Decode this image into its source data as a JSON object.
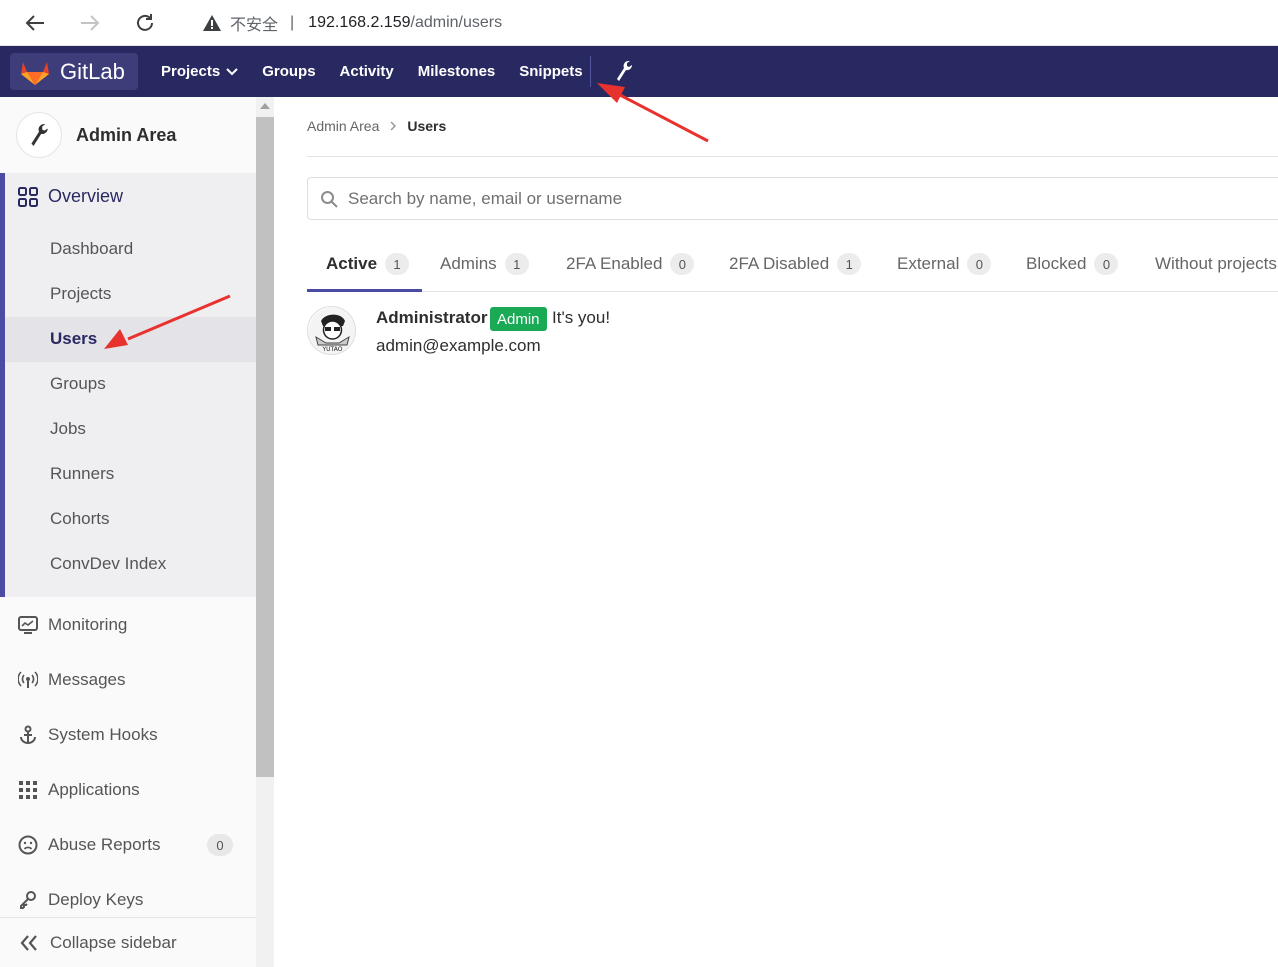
{
  "browser": {
    "warning_label": "不安全",
    "url_host": "192.168.2.159",
    "url_path": "/admin/users"
  },
  "header": {
    "logo_text": "GitLab",
    "nav": [
      {
        "label": "Projects"
      },
      {
        "label": "Groups"
      },
      {
        "label": "Activity"
      },
      {
        "label": "Milestones"
      },
      {
        "label": "Snippets"
      }
    ],
    "colors": {
      "bg": "#292961",
      "accent": "#fc6d26"
    }
  },
  "sidebar": {
    "title": "Admin Area",
    "overview": {
      "label": "Overview",
      "items": [
        {
          "label": "Dashboard"
        },
        {
          "label": "Projects"
        },
        {
          "label": "Users"
        },
        {
          "label": "Groups"
        },
        {
          "label": "Jobs"
        },
        {
          "label": "Runners"
        },
        {
          "label": "Cohorts"
        },
        {
          "label": "ConvDev Index"
        }
      ],
      "active_item": "Users"
    },
    "items": [
      {
        "label": "Monitoring",
        "icon": "monitor-icon"
      },
      {
        "label": "Messages",
        "icon": "broadcast-icon"
      },
      {
        "label": "System Hooks",
        "icon": "anchor-icon"
      },
      {
        "label": "Applications",
        "icon": "apps-grid-icon"
      },
      {
        "label": "Abuse Reports",
        "icon": "frown-face-icon",
        "count": "0"
      },
      {
        "label": "Deploy Keys",
        "icon": "key-icon"
      }
    ],
    "collapse_label": "Collapse sidebar"
  },
  "breadcrumb": {
    "parent": "Admin Area",
    "current": "Users"
  },
  "search": {
    "placeholder": "Search by name, email or username"
  },
  "tabs": [
    {
      "label": "Active",
      "count": "1"
    },
    {
      "label": "Admins",
      "count": "1"
    },
    {
      "label": "2FA Enabled",
      "count": "0"
    },
    {
      "label": "2FA Disabled",
      "count": "1"
    },
    {
      "label": "External",
      "count": "0"
    },
    {
      "label": "Blocked",
      "count": "0"
    },
    {
      "label": "Without projects"
    }
  ],
  "users": [
    {
      "name": "Administrator",
      "badge": "Admin",
      "note": "It's you!",
      "email": "admin@example.com",
      "avatar_text": "YUTAO"
    }
  ]
}
